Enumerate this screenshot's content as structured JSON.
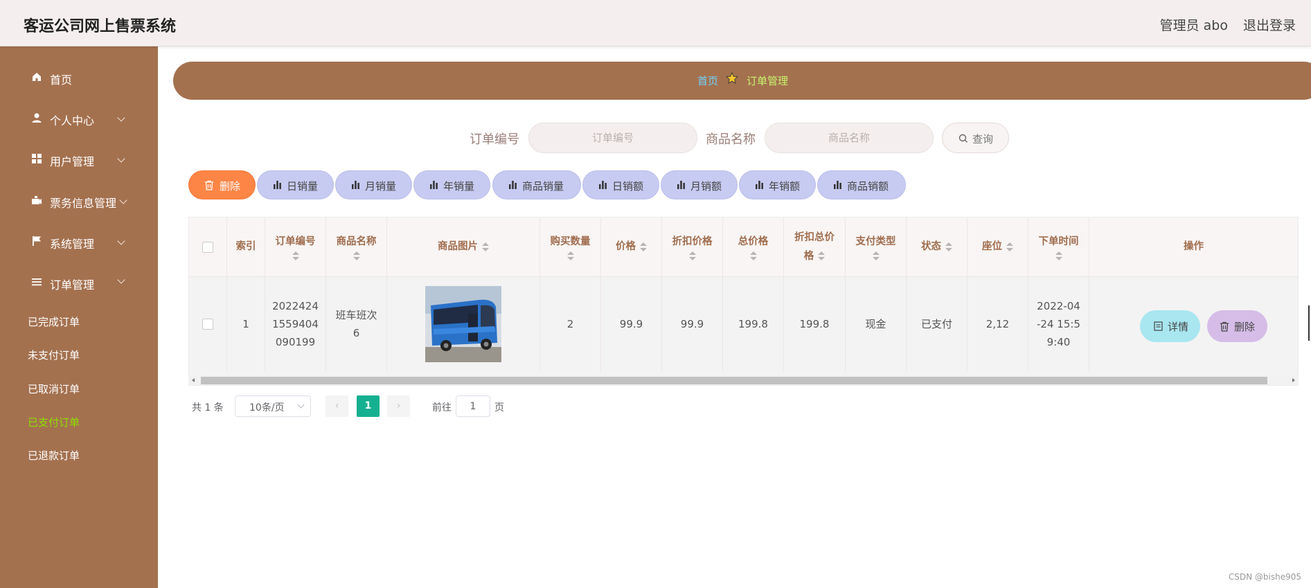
{
  "header": {
    "title": "客运公司网上售票系统",
    "user": "管理员 abo",
    "logout": "退出登录"
  },
  "sidebar": {
    "items": [
      {
        "label": "首页",
        "icon": "home-icon"
      },
      {
        "label": "个人中心",
        "icon": "user-icon"
      },
      {
        "label": "用户管理",
        "icon": "grid-icon"
      },
      {
        "label": "票务信息管理",
        "icon": "ticket-icon"
      },
      {
        "label": "系统管理",
        "icon": "flag-icon"
      },
      {
        "label": "订单管理",
        "icon": "list-icon"
      }
    ],
    "sub_items": [
      "已完成订单",
      "未支付订单",
      "已取消订单",
      "已支付订单",
      "已退款订单"
    ],
    "active_sub": "已支付订单"
  },
  "breadcrumb": {
    "home": "首页",
    "current": "订单管理"
  },
  "search": {
    "order_label": "订单编号",
    "order_placeholder": "订单编号",
    "product_label": "商品名称",
    "product_placeholder": "商品名称",
    "query": "查询"
  },
  "actions": [
    "删除",
    "日销量",
    "月销量",
    "年销量",
    "商品销量",
    "日销额",
    "月销额",
    "年销额",
    "商品销额"
  ],
  "table": {
    "headers": {
      "index": "索引",
      "order_no_1": "订单编号",
      "product_name": "商品名称",
      "product_image": "商品图片",
      "qty": "购买数量",
      "price": "价格",
      "discount_price": "折扣价格",
      "total": "总价格",
      "discount_total_1": "折扣总价",
      "discount_total_2": "格",
      "pay_type": "支付类型",
      "status": "状态",
      "seat": "座位",
      "order_time": "下单时间",
      "ops": "操作"
    },
    "row": {
      "index": "1",
      "order_no": [
        "2022424",
        "1559404",
        "090199"
      ],
      "product_name": [
        "班车班次",
        "6"
      ],
      "qty": "2",
      "price": "99.9",
      "discount_price": "99.9",
      "total": "199.8",
      "discount_total": "199.8",
      "pay_type": "现金",
      "status": "已支付",
      "seat": "2,12",
      "order_time": [
        "2022-04",
        "-24 15:5",
        "9:40"
      ],
      "detail": "详情",
      "delete": "删除"
    }
  },
  "pagination": {
    "total": "共 1 条",
    "page_size": "10条/页",
    "current": "1",
    "goto": "前往",
    "goto_value": "1",
    "page_suffix": "页"
  },
  "watermark": "CSDN @bishe905",
  "colors": {
    "sidebar": "#a4714f",
    "active_sub": "#8be000",
    "delete_btn": "#fd8546",
    "stat_btn": "#c7cbf2",
    "detail_btn": "#a8e6f0",
    "row_delete_btn": "#d6bde8",
    "page_active": "#15b090"
  }
}
